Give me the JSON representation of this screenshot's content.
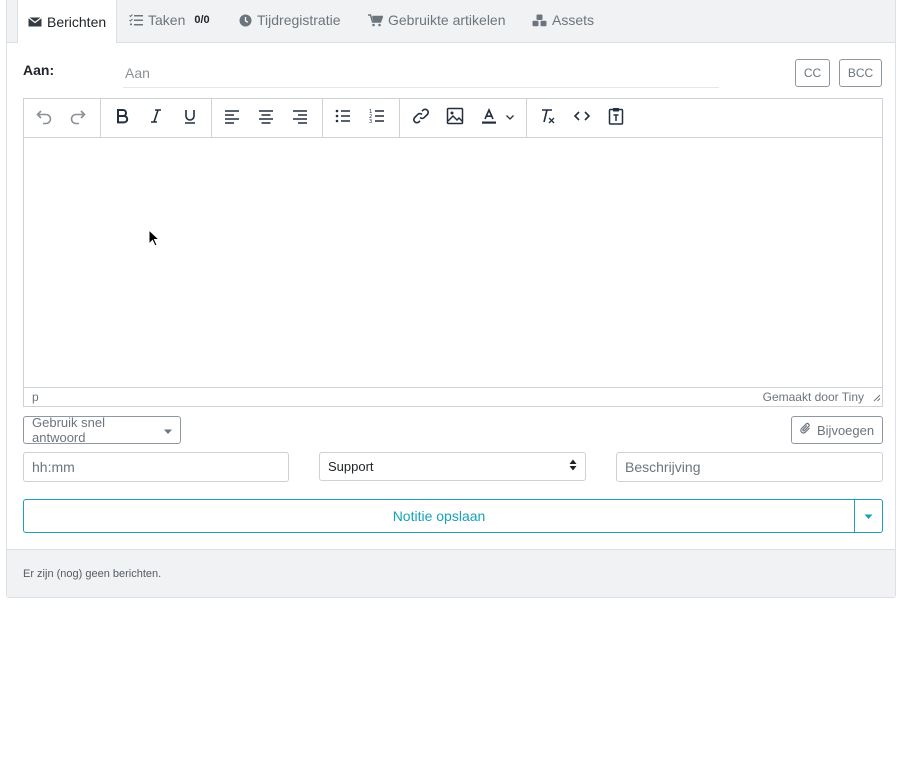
{
  "tabs": [
    {
      "label": "Berichten",
      "icon": "envelope-icon"
    },
    {
      "label": "Taken",
      "count": "0/0",
      "icon": "tasks-icon"
    },
    {
      "label": "Tijdregistratie",
      "icon": "clock-icon"
    },
    {
      "label": "Gebruikte artikelen",
      "icon": "cart-icon"
    },
    {
      "label": "Assets",
      "icon": "cubes-icon"
    }
  ],
  "compose": {
    "to_label": "Aan:",
    "to_placeholder": "Aan",
    "cc_label": "CC",
    "bcc_label": "BCC"
  },
  "editor": {
    "status_path": "p",
    "branding": "Gemaakt door Tiny"
  },
  "actions": {
    "quick_reply_label": "Gebruik snel antwoord",
    "attach_label": "Bijvoegen",
    "time_placeholder": "hh:mm",
    "category_selected": "Support",
    "description_placeholder": "Beschrijving",
    "save_label": "Notitie opslaan"
  },
  "footer": {
    "message": "Er zijn (nog) geen berichten."
  },
  "colors": {
    "accent": "#17a2b8",
    "tabbar_bg": "#f1f2f4",
    "border": "#cdd2d7"
  }
}
